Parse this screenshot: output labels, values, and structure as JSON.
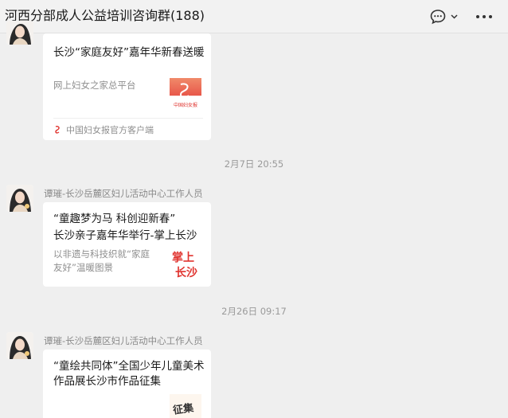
{
  "header": {
    "title": "河西分部成人公益培训咨询群(188)"
  },
  "colors": {
    "background": "#efefef",
    "card": "#ffffff",
    "meta_text": "#8e8e8e",
    "thumb_red": "#e0342f",
    "thumb_salmon": "#f08a6a"
  },
  "messages": [
    {
      "card_title": "长沙“家庭友好”嘉年华新春送暖",
      "card_desc": "网上妇女之家总平台",
      "thumb_text": "中国妇女报",
      "footer_source": "中国妇女报官方客户端"
    },
    {
      "timestamp": "2月7日 20:55",
      "sender": "谭璀-长沙岳麓区妇儿活动中心工作人员",
      "card_title_line1": "“童趣梦为马 科创迎新春”",
      "card_title_line2": "长沙亲子嘉年华举行-掌上长沙",
      "card_desc": "以非遗与科技织就“家庭友好”温暖图景",
      "thumb_line1": "掌上",
      "thumb_line2": "长沙"
    },
    {
      "timestamp": "2月26日 09:17",
      "sender": "谭璀-长沙岳麓区妇儿活动中心工作人员",
      "card_title": "“童绘共同体”全国少年儿童美术作品展长沙市作品征集",
      "thumb_text": "征集"
    }
  ]
}
